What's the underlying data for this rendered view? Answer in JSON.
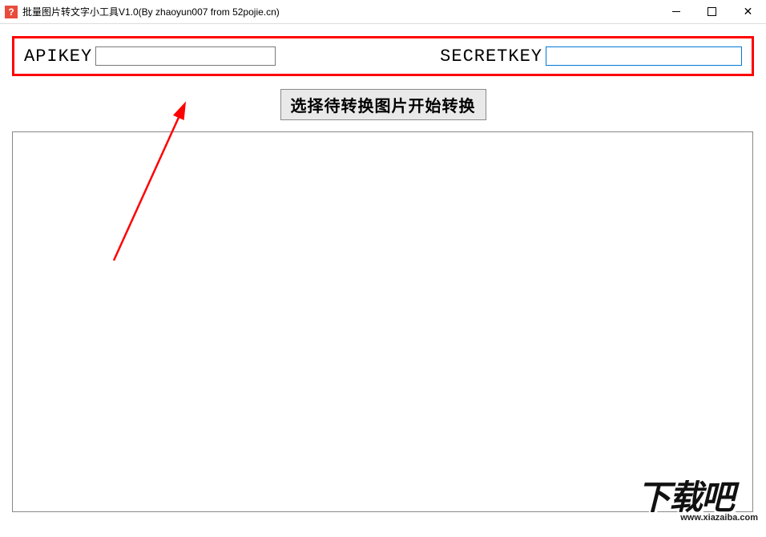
{
  "window": {
    "title": "批量图片转文字小工具V1.0(By zhaoyun007 from 52pojie.cn)",
    "icon_glyph": "?"
  },
  "keys": {
    "api_label": "APIKEY",
    "api_value": "",
    "secret_label": "SECRETKEY",
    "secret_value": ""
  },
  "actions": {
    "convert_button": "选择待转换图片开始转换"
  },
  "watermark": {
    "brand": "下载吧",
    "url": "www.xiazaiba.com"
  }
}
